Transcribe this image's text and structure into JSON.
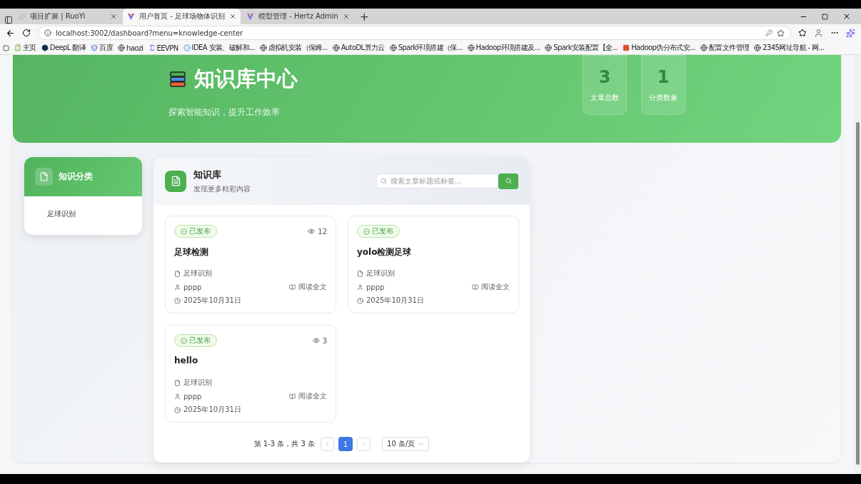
{
  "browser": {
    "tabs": [
      {
        "title": "项目扩展 | RuoYi",
        "selected": false
      },
      {
        "title": "用户首页 - 足球场物体识别",
        "selected": true
      },
      {
        "title": "模型管理 - Hertz Admin",
        "selected": false
      }
    ],
    "new_tab": "+",
    "address": "localhost:3002/dashboard?menu=knowledge-center",
    "bookmarks": [
      {
        "label": "主页"
      },
      {
        "label": "DeepL 翻译"
      },
      {
        "label": "百度"
      },
      {
        "label": "haozi"
      },
      {
        "label": "EEVPN"
      },
      {
        "label": "IDEA 安装、破解和..."
      },
      {
        "label": "虚拟机安装（保姆..."
      },
      {
        "label": "AutoDL算力云"
      },
      {
        "label": "Spark环境搭建（保..."
      },
      {
        "label": "Hadoop环境搭建及..."
      },
      {
        "label": "Spark安装配置【全..."
      },
      {
        "label": "Hadoop伪分布式安..."
      },
      {
        "label": "配置文件管理"
      },
      {
        "label": "2345网址导航 - 网..."
      }
    ]
  },
  "header": {
    "title": "知识库中心",
    "subtitle": "探索智能知识，提升工作效率",
    "stats": [
      {
        "value": "3",
        "label": "文章总数"
      },
      {
        "value": "1",
        "label": "分类数量"
      }
    ]
  },
  "sidebar": {
    "title": "知识分类",
    "items": [
      {
        "label": "足球识别",
        "selected": false
      }
    ]
  },
  "main": {
    "title": "知识库",
    "subtitle": "发现更多精彩内容",
    "search_placeholder": "搜索文章标题或标签...",
    "articles": [
      {
        "status": "已发布",
        "views": "12",
        "title": "足球检测",
        "category": "足球识别",
        "author": "pppp",
        "read": "阅读全文",
        "date": "2025年10月31日"
      },
      {
        "status": "已发布",
        "title": "yolo检测足球",
        "category": "足球识别",
        "author": "pppp",
        "read": "阅读全文",
        "date": "2025年10月31日"
      },
      {
        "status": "已发布",
        "views": "3",
        "title": "hello",
        "category": "足球识别",
        "author": "pppp",
        "read": "阅读全文",
        "date": "2025年10月31日"
      }
    ],
    "pagination": {
      "summary": "第 1-3 条，共 3 条",
      "pages": [
        {
          "label": "1",
          "selected": true
        }
      ],
      "page_size": "10 条/页"
    }
  }
}
